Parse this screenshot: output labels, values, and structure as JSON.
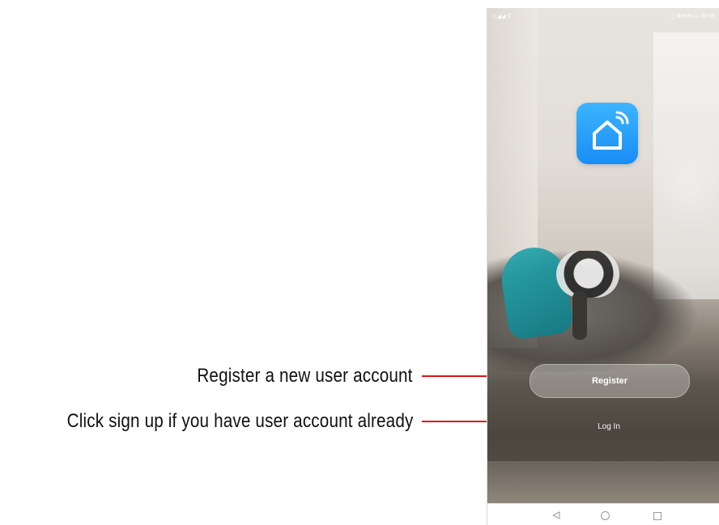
{
  "annotations": [
    {
      "text": "Register a new user account",
      "target": "register-button"
    },
    {
      "text": "Click sign up if you have user account already",
      "target": "login-link"
    }
  ],
  "colors": {
    "arrow": "#e0141b",
    "app_icon": "#1a8df5"
  },
  "phone": {
    "status_bar": {
      "left": "▯ ◢◢ ⚲",
      "right": "▯ ⊕86% ▭ 09:58"
    },
    "app_icon": "smart-home-wifi-icon",
    "buttons": {
      "register_label": "Register",
      "login_label": "Log In"
    },
    "nav_icons": [
      "back-icon",
      "home-icon",
      "recent-apps-icon"
    ]
  }
}
